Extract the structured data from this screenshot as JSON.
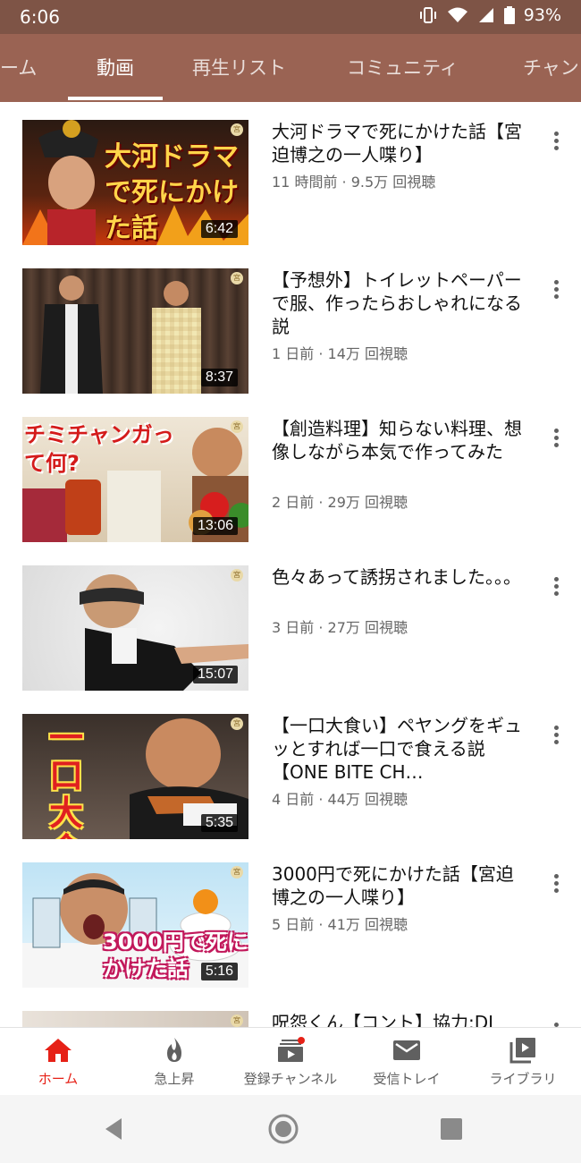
{
  "status": {
    "time": "6:06",
    "battery": "93%"
  },
  "tabs": [
    "ーム",
    "動画",
    "再生リスト",
    "コミュニティ",
    "チャン"
  ],
  "active_tab": "動画",
  "videos": [
    {
      "title": "大河ドラマで死にかけた話【宮迫博之の一人喋り】",
      "meta": "11 時間前 · 9.5万 回視聴",
      "duration": "6:42",
      "thumb_text": "大河ドラマで死にかけた話"
    },
    {
      "title": "【予想外】トイレットペーパーで服、作ったらおしゃれになる説",
      "meta": "1 日前 · 14万 回視聴",
      "duration": "8:37"
    },
    {
      "title": "【創造料理】知らない料理、想像しながら本気で作ってみた",
      "meta": "2 日前 · 29万 回視聴",
      "duration": "13:06",
      "thumb_text": "チミチャンガって何?"
    },
    {
      "title": "色々あって誘拐されました。。。",
      "meta": "3 日前 · 27万 回視聴",
      "duration": "15:07"
    },
    {
      "title": "【一口大食い】ペヤングをギュッとすれば一口で食える説【ONE BITE CH…",
      "meta": "4 日前 · 44万 回視聴",
      "duration": "5:35",
      "thumb_text": "一口大食"
    },
    {
      "title": "3000円で死にかけた話【宮迫博之の一人喋り】",
      "meta": "5 日前 · 41万 回視聴",
      "duration": "5:16",
      "thumb_text": "3000円で死にかけた話"
    },
    {
      "title": "呪怨くん【コント】協力:DJ",
      "meta": "",
      "duration": ""
    }
  ],
  "bottom_nav": [
    {
      "label": "ホーム",
      "icon": "home-icon",
      "active": true
    },
    {
      "label": "急上昇",
      "icon": "flame-icon",
      "active": false
    },
    {
      "label": "登録チャンネル",
      "icon": "subscriptions-icon",
      "active": false
    },
    {
      "label": "受信トレイ",
      "icon": "mail-icon",
      "active": false
    },
    {
      "label": "ライブラリ",
      "icon": "library-icon",
      "active": false
    }
  ],
  "colors": {
    "header": "#9a6353",
    "statusbar": "#7e5446",
    "accent": "#e62117"
  },
  "thumb_mark": "宮"
}
